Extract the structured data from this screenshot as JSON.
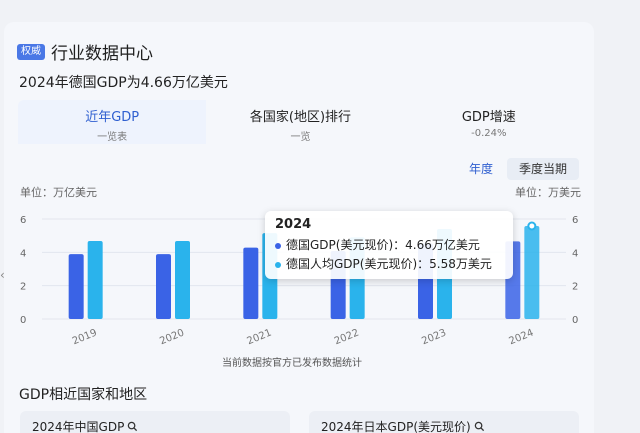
{
  "header": {
    "badge": "权威",
    "title": "行业数据中心"
  },
  "subtitle": "2024年德国GDP为4.66万亿美元",
  "tabs": [
    {
      "label": "近年GDP",
      "sub": "一览表",
      "active": true
    },
    {
      "label": "各国家(地区)排行",
      "sub": "一览"
    },
    {
      "label": "GDP增速",
      "sub": "-0.24%"
    }
  ],
  "toggles": {
    "year": "年度",
    "quarter": "季度当期"
  },
  "units": {
    "left": "单位：万亿美元",
    "right": "单位：万美元"
  },
  "colors": {
    "gdp": "#3a63e6",
    "per_capita": "#2ab3ec",
    "accent": "#2f5fd0"
  },
  "chart_data": {
    "type": "bar",
    "categories": [
      "2019",
      "2020",
      "2021",
      "2022",
      "2023",
      "2024"
    ],
    "series": [
      {
        "name": "德国GDP(美元现价)",
        "values": [
          3.89,
          3.89,
          4.28,
          4.08,
          4.53,
          4.66
        ]
      },
      {
        "name": "德国人均GDP(美元现价)",
        "values": [
          4.68,
          4.68,
          5.15,
          4.9,
          5.4,
          5.58
        ]
      }
    ],
    "y_left": {
      "ticks": [
        "6",
        "4",
        "2",
        "0"
      ],
      "ylim": [
        0,
        6
      ]
    },
    "y_right": {
      "ticks": [
        "6",
        "4",
        "2",
        "0"
      ],
      "ylim": [
        0,
        6
      ]
    },
    "highlight_category": "2024"
  },
  "tooltip": {
    "year": "2024",
    "rows": [
      "德国GDP(美元现价)：4.66万亿美元",
      "德国人均GDP(美元现价)：5.58万美元"
    ]
  },
  "note": "当前数据按官方已发布数据统计",
  "section_title": "GDP相近国家和地区",
  "mini_cards": [
    "2024年中国GDP",
    "2024年日本GDP(美元现价)"
  ],
  "icons": {
    "side": "chevron-left-icon",
    "search": "search-icon"
  }
}
